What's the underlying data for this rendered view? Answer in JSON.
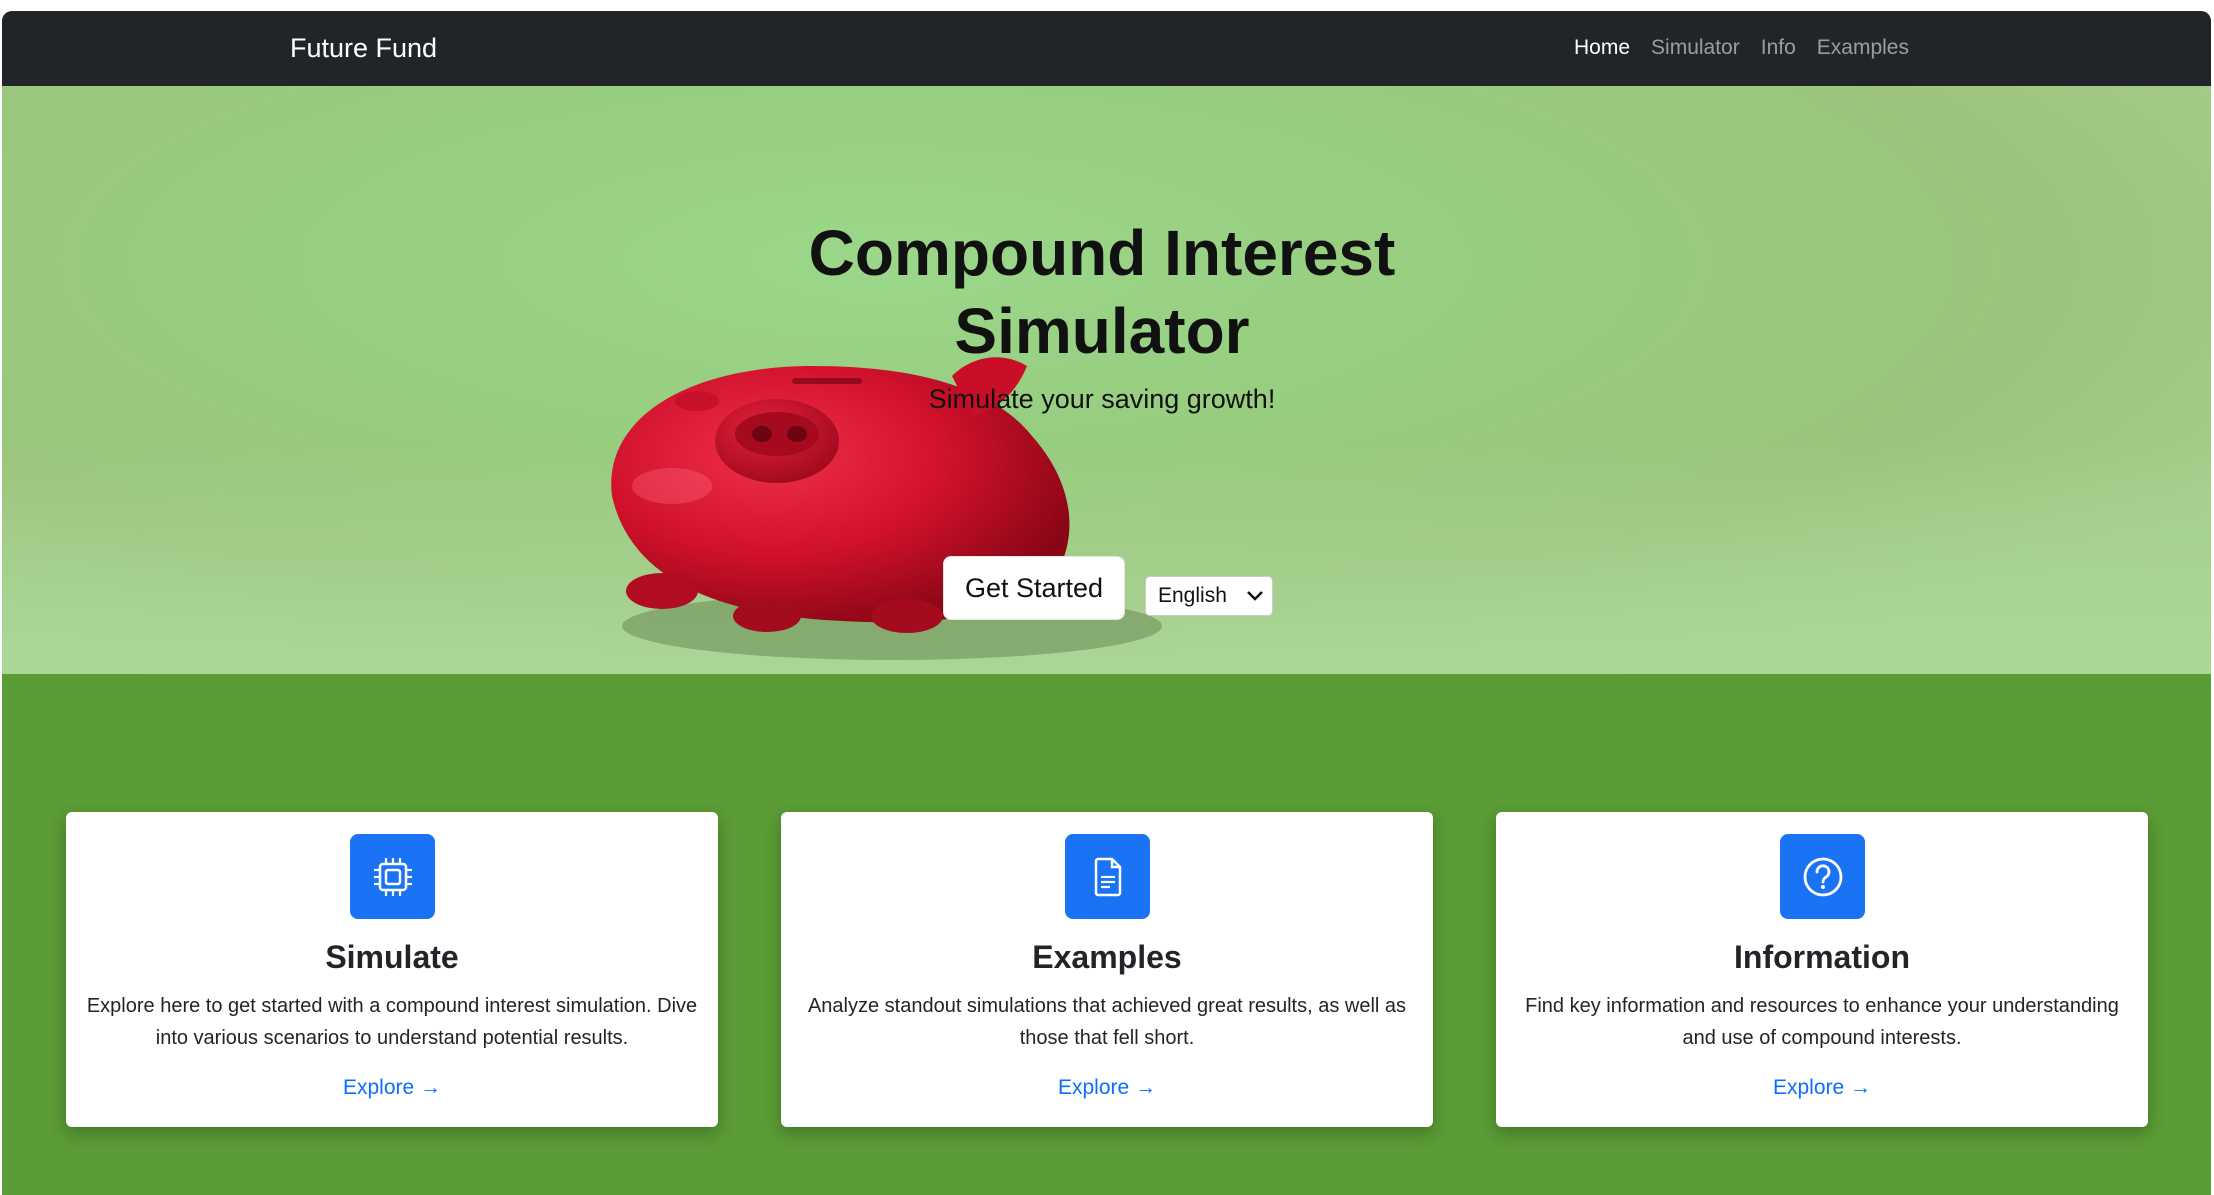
{
  "navbar": {
    "brand": "Future Fund",
    "links": [
      "Home",
      "Simulator",
      "Info",
      "Examples"
    ]
  },
  "hero": {
    "title": "Compound Interest Simulator",
    "subtitle": "Simulate your saving growth!",
    "cta_label": "Get Started",
    "language_selected": "English"
  },
  "cards": [
    {
      "icon": "cpu-chip-icon",
      "title": "Simulate",
      "text": "Explore here to get started with a compound interest simulation. Dive into various scenarios to understand potential results.",
      "link": "Explore →"
    },
    {
      "icon": "document-icon",
      "title": "Examples",
      "text": "Analyze standout simulations that achieved great results, as well as those that fell short.",
      "link": "Explore →"
    },
    {
      "icon": "question-circle-icon",
      "title": "Information",
      "text": "Find key information and resources to enhance your understanding and use of compound interests.",
      "link": "Explore →"
    }
  ],
  "colors": {
    "navbar": "#212529",
    "feature_background": "#5a9c35",
    "icon_tile": "#1a73f4",
    "link": "#0d6efd"
  }
}
